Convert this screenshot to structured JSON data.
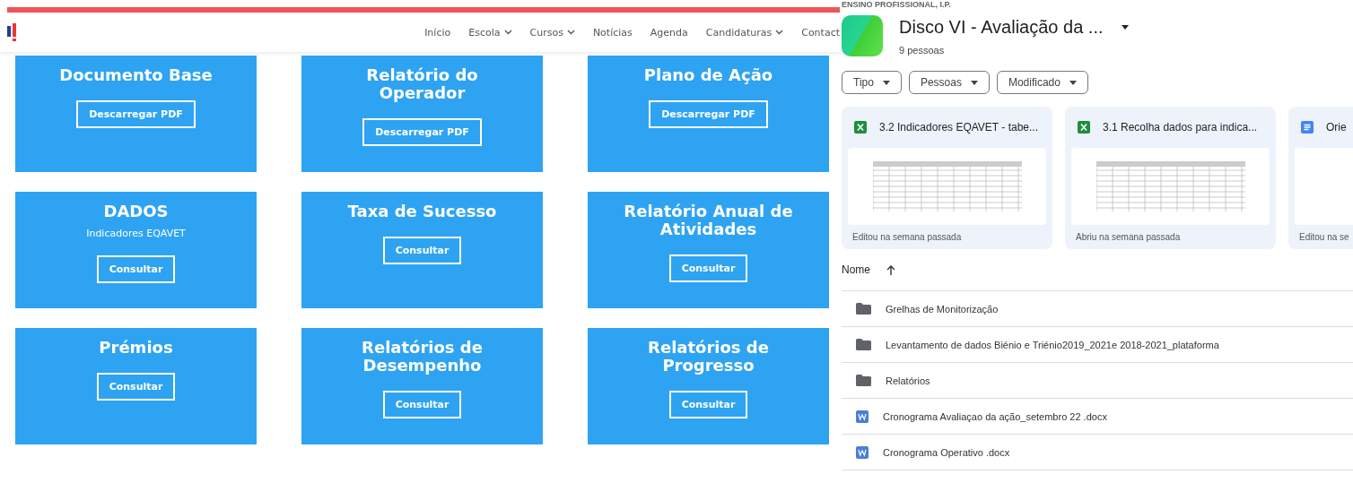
{
  "site": {
    "nav": [
      {
        "label": "Início",
        "dropdown": false
      },
      {
        "label": "Escola",
        "dropdown": true
      },
      {
        "label": "Cursos",
        "dropdown": true
      },
      {
        "label": "Notícias",
        "dropdown": false
      },
      {
        "label": "Agenda",
        "dropdown": false
      },
      {
        "label": "Candidaturas",
        "dropdown": true
      },
      {
        "label": "Contact",
        "dropdown": false
      }
    ],
    "cards": [
      {
        "title": "Documento Base",
        "button": "Descarregar PDF"
      },
      {
        "title": "Relatório do Operador",
        "button": "Descarregar PDF"
      },
      {
        "title": "Plano de Ação",
        "button": "Descarregar PDF"
      },
      {
        "title": "DADOS",
        "subtitle": "Indicadores EQAVET",
        "button": "Consultar"
      },
      {
        "title": "Taxa de Sucesso",
        "button": "Consultar"
      },
      {
        "title": "Relatório Anual de Atividades",
        "button": "Consultar"
      },
      {
        "title": "Prémios",
        "button": "Consultar"
      },
      {
        "title": "Relatórios de Desempenho",
        "button": "Consultar"
      },
      {
        "title": "Relatórios de Progresso",
        "button": "Consultar"
      }
    ]
  },
  "drive": {
    "org": "ENSINO PROFISSIONAL, I.P.",
    "title": "Disco VI - Avaliação da ...",
    "members": "9 pessoas",
    "filters": [
      "Tipo",
      "Pessoas",
      "Modificado"
    ],
    "suggested": [
      {
        "kind": "sheet",
        "name": "3.2 Indicadores EQAVET - tabe...",
        "activity": "Editou na semana passada"
      },
      {
        "kind": "sheet",
        "name": "3.1 Recolha dados para indica...",
        "activity": "Abriu na semana passada"
      },
      {
        "kind": "doc",
        "name": "Orie",
        "activity": "Editou na se"
      }
    ],
    "sort_column": "Nome",
    "files": [
      {
        "kind": "folder",
        "name": "Grelhas de Monitorização"
      },
      {
        "kind": "folder",
        "name": "Levantamento de dados Biénio e Triénio2019_2021e 2018-2021_plataforma"
      },
      {
        "kind": "folder",
        "name": "Relatórios"
      },
      {
        "kind": "word",
        "name": "Cronograma Avaliaçao da ação_setembro 22 .docx"
      },
      {
        "kind": "word",
        "name": "Cronograma Operativo .docx"
      }
    ]
  }
}
